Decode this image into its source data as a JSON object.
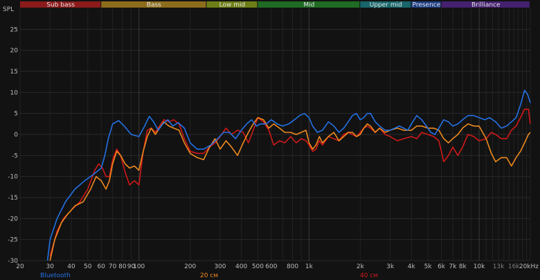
{
  "chart_data": {
    "type": "line",
    "ylabel": "SPL",
    "xscale": "log",
    "xlim": [
      20,
      20000
    ],
    "ylim": [
      -30,
      30
    ],
    "grid": true,
    "legend_position": "bottom",
    "bands": [
      {
        "name": "Sub bass",
        "from": 20,
        "to": 60,
        "color": "#8b1a1a"
      },
      {
        "name": "Bass",
        "from": 60,
        "to": 250,
        "color": "#8d6d1c"
      },
      {
        "name": "Low mid",
        "from": 250,
        "to": 500,
        "color": "#6d7e16"
      },
      {
        "name": "Mid",
        "from": 500,
        "to": 2000,
        "color": "#1f6b23"
      },
      {
        "name": "Upper mid",
        "from": 2000,
        "to": 4000,
        "color": "#18666b"
      },
      {
        "name": "Presence",
        "from": 4000,
        "to": 6000,
        "color": "#1d3d84"
      },
      {
        "name": "Brilliance",
        "from": 6000,
        "to": 20000,
        "color": "#45206f"
      }
    ],
    "x_ticks": [
      {
        "v": 20,
        "label": "20"
      },
      {
        "v": 30,
        "label": "30"
      },
      {
        "v": 40,
        "label": "40"
      },
      {
        "v": 50,
        "label": "50"
      },
      {
        "v": 60,
        "label": "60"
      },
      {
        "v": 70,
        "label": "70"
      },
      {
        "v": 80,
        "label": "80"
      },
      {
        "v": 90,
        "label": "90"
      },
      {
        "v": 100,
        "label": "100"
      },
      {
        "v": 200,
        "label": "200"
      },
      {
        "v": 300,
        "label": "300"
      },
      {
        "v": 400,
        "label": "400"
      },
      {
        "v": 500,
        "label": "500"
      },
      {
        "v": 600,
        "label": "600"
      },
      {
        "v": 800,
        "label": "800"
      },
      {
        "v": 1000,
        "label": "1k"
      },
      {
        "v": 2000,
        "label": "2k"
      },
      {
        "v": 3000,
        "label": "3k"
      },
      {
        "v": 4000,
        "label": "4k"
      },
      {
        "v": 5000,
        "label": "5k"
      },
      {
        "v": 6000,
        "label": "6k"
      },
      {
        "v": 7000,
        "label": "7k"
      },
      {
        "v": 8000,
        "label": "8k"
      },
      {
        "v": 10000,
        "label": "10k"
      },
      {
        "v": 13000,
        "label": "13k",
        "dim": true
      },
      {
        "v": 16000,
        "label": "16k",
        "dim": true
      },
      {
        "v": 20000,
        "label": "20kHz"
      }
    ],
    "y_ticks": [
      -30,
      -25,
      -20,
      -15,
      -10,
      -5,
      0,
      5,
      10,
      15,
      20,
      25
    ],
    "series": [
      {
        "name": "Bluetooth",
        "color": "#2472e6",
        "points": [
          [
            29,
            -30
          ],
          [
            30,
            -25
          ],
          [
            33,
            -20
          ],
          [
            37,
            -16
          ],
          [
            42,
            -13
          ],
          [
            48,
            -11
          ],
          [
            54,
            -9.5
          ],
          [
            60,
            -8
          ],
          [
            63,
            -5
          ],
          [
            66,
            -1
          ],
          [
            70,
            2.5
          ],
          [
            76,
            3.3
          ],
          [
            82,
            2
          ],
          [
            90,
            0
          ],
          [
            100,
            -0.5
          ],
          [
            108,
            2
          ],
          [
            115,
            4.3
          ],
          [
            122,
            3
          ],
          [
            130,
            1
          ],
          [
            138,
            2.5
          ],
          [
            148,
            3.5
          ],
          [
            158,
            2
          ],
          [
            170,
            2.8
          ],
          [
            185,
            1.5
          ],
          [
            200,
            -2
          ],
          [
            220,
            -3.5
          ],
          [
            240,
            -3.5
          ],
          [
            265,
            -2.5
          ],
          [
            290,
            -1
          ],
          [
            315,
            0.5
          ],
          [
            340,
            0.5
          ],
          [
            370,
            -1
          ],
          [
            400,
            1
          ],
          [
            430,
            2.5
          ],
          [
            460,
            3.5
          ],
          [
            490,
            2
          ],
          [
            520,
            2.5
          ],
          [
            560,
            2.5
          ],
          [
            600,
            3.5
          ],
          [
            650,
            2.5
          ],
          [
            700,
            2
          ],
          [
            760,
            2.5
          ],
          [
            820,
            3.5
          ],
          [
            880,
            4.5
          ],
          [
            940,
            5
          ],
          [
            1000,
            4
          ],
          [
            1050,
            2
          ],
          [
            1120,
            0.5
          ],
          [
            1200,
            1
          ],
          [
            1300,
            3
          ],
          [
            1400,
            2
          ],
          [
            1500,
            0.5
          ],
          [
            1600,
            1.5
          ],
          [
            1700,
            3
          ],
          [
            1800,
            4.5
          ],
          [
            1900,
            5
          ],
          [
            2000,
            3.5
          ],
          [
            2100,
            4
          ],
          [
            2200,
            5
          ],
          [
            2300,
            5
          ],
          [
            2450,
            3
          ],
          [
            2600,
            2
          ],
          [
            2800,
            1
          ],
          [
            3000,
            1
          ],
          [
            3200,
            1.5
          ],
          [
            3400,
            2
          ],
          [
            3600,
            1.5
          ],
          [
            3800,
            1
          ],
          [
            4000,
            2.5
          ],
          [
            4300,
            4.5
          ],
          [
            4600,
            3.5
          ],
          [
            4900,
            2
          ],
          [
            5200,
            0.5
          ],
          [
            5500,
            0
          ],
          [
            5800,
            1.5
          ],
          [
            6200,
            3.5
          ],
          [
            6600,
            3
          ],
          [
            7000,
            2
          ],
          [
            7500,
            2.5
          ],
          [
            8000,
            3.5
          ],
          [
            8600,
            4.5
          ],
          [
            9300,
            4.5
          ],
          [
            10000,
            4
          ],
          [
            10800,
            3.5
          ],
          [
            11500,
            4
          ],
          [
            12500,
            3
          ],
          [
            13500,
            1.5
          ],
          [
            14500,
            2
          ],
          [
            15500,
            3
          ],
          [
            16500,
            4
          ],
          [
            17500,
            7
          ],
          [
            18500,
            10.5
          ],
          [
            19300,
            9.5
          ],
          [
            20000,
            7.5
          ]
        ]
      },
      {
        "name": "20 см",
        "color": "#f08a1e",
        "points": [
          [
            30,
            -30
          ],
          [
            32,
            -25
          ],
          [
            35,
            -21
          ],
          [
            38,
            -19
          ],
          [
            42,
            -17
          ],
          [
            47,
            -16
          ],
          [
            52,
            -13
          ],
          [
            56,
            -10
          ],
          [
            60,
            -11
          ],
          [
            64,
            -13
          ],
          [
            67,
            -11
          ],
          [
            70,
            -7
          ],
          [
            74,
            -4
          ],
          [
            78,
            -5
          ],
          [
            83,
            -7
          ],
          [
            88,
            -8
          ],
          [
            94,
            -7.5
          ],
          [
            100,
            -8.5
          ],
          [
            106,
            -4
          ],
          [
            112,
            -0.5
          ],
          [
            118,
            1.5
          ],
          [
            125,
            0
          ],
          [
            132,
            1.5
          ],
          [
            140,
            3
          ],
          [
            150,
            2
          ],
          [
            160,
            1.5
          ],
          [
            172,
            1
          ],
          [
            185,
            -2
          ],
          [
            200,
            -4.5
          ],
          [
            220,
            -5.5
          ],
          [
            240,
            -6
          ],
          [
            260,
            -3
          ],
          [
            280,
            -1
          ],
          [
            300,
            -3.5
          ],
          [
            325,
            -1.5
          ],
          [
            350,
            -3
          ],
          [
            380,
            -5
          ],
          [
            410,
            -2
          ],
          [
            440,
            0.5
          ],
          [
            470,
            2.5
          ],
          [
            500,
            4
          ],
          [
            540,
            3.5
          ],
          [
            580,
            1.5
          ],
          [
            620,
            2.5
          ],
          [
            670,
            1.5
          ],
          [
            720,
            0.5
          ],
          [
            780,
            0.5
          ],
          [
            840,
            0
          ],
          [
            900,
            0.5
          ],
          [
            960,
            1
          ],
          [
            1000,
            -2
          ],
          [
            1050,
            -3.5
          ],
          [
            1100,
            -2.5
          ],
          [
            1150,
            -0.5
          ],
          [
            1200,
            -2
          ],
          [
            1300,
            -0.5
          ],
          [
            1400,
            0.5
          ],
          [
            1500,
            -1.5
          ],
          [
            1600,
            -0.5
          ],
          [
            1700,
            0.5
          ],
          [
            1800,
            0.5
          ],
          [
            1900,
            -0.5
          ],
          [
            2000,
            0
          ],
          [
            2100,
            1.5
          ],
          [
            2200,
            2.5
          ],
          [
            2300,
            2
          ],
          [
            2450,
            0.5
          ],
          [
            2600,
            1.5
          ],
          [
            2800,
            0.5
          ],
          [
            3000,
            1
          ],
          [
            3300,
            1.5
          ],
          [
            3600,
            1
          ],
          [
            4000,
            1
          ],
          [
            4300,
            2
          ],
          [
            4600,
            2
          ],
          [
            5000,
            1.5
          ],
          [
            5400,
            1.5
          ],
          [
            5800,
            1
          ],
          [
            6200,
            -1
          ],
          [
            6600,
            -2
          ],
          [
            7000,
            -1
          ],
          [
            7500,
            0
          ],
          [
            8000,
            1.5
          ],
          [
            8600,
            2.5
          ],
          [
            9300,
            2
          ],
          [
            10000,
            2
          ],
          [
            11000,
            -1
          ],
          [
            11800,
            -4.5
          ],
          [
            12500,
            -6.5
          ],
          [
            13500,
            -5.5
          ],
          [
            14500,
            -5.5
          ],
          [
            15500,
            -7.5
          ],
          [
            16500,
            -5.5
          ],
          [
            17500,
            -4
          ],
          [
            18500,
            -2
          ],
          [
            19500,
            0
          ],
          [
            20000,
            0.5
          ]
        ]
      },
      {
        "name": "40 см",
        "color": "#d11919",
        "points": [
          [
            30,
            -29
          ],
          [
            33,
            -23
          ],
          [
            36,
            -20
          ],
          [
            40,
            -18
          ],
          [
            45,
            -16
          ],
          [
            50,
            -13
          ],
          [
            55,
            -8.5
          ],
          [
            58,
            -7
          ],
          [
            61,
            -8
          ],
          [
            64,
            -10
          ],
          [
            67,
            -10
          ],
          [
            70,
            -6
          ],
          [
            74,
            -3.5
          ],
          [
            78,
            -5
          ],
          [
            83,
            -9
          ],
          [
            88,
            -12
          ],
          [
            94,
            -11
          ],
          [
            100,
            -12
          ],
          [
            106,
            -4
          ],
          [
            112,
            1
          ],
          [
            118,
            1.5
          ],
          [
            125,
            0.5
          ],
          [
            132,
            2
          ],
          [
            140,
            3.5
          ],
          [
            150,
            3
          ],
          [
            160,
            3.5
          ],
          [
            172,
            2.5
          ],
          [
            185,
            -1
          ],
          [
            200,
            -4
          ],
          [
            220,
            -4.5
          ],
          [
            240,
            -4.5
          ],
          [
            260,
            -3
          ],
          [
            280,
            -2
          ],
          [
            300,
            -0.5
          ],
          [
            325,
            1.5
          ],
          [
            350,
            0
          ],
          [
            380,
            1
          ],
          [
            410,
            0.5
          ],
          [
            440,
            -2
          ],
          [
            470,
            1
          ],
          [
            500,
            4
          ],
          [
            540,
            3
          ],
          [
            580,
            1
          ],
          [
            620,
            -2.5
          ],
          [
            670,
            -1.5
          ],
          [
            720,
            -2
          ],
          [
            780,
            -0.5
          ],
          [
            840,
            -2
          ],
          [
            900,
            -1
          ],
          [
            960,
            -1.5
          ],
          [
            1000,
            -2.5
          ],
          [
            1050,
            -4
          ],
          [
            1100,
            -3.5
          ],
          [
            1150,
            -1.5
          ],
          [
            1200,
            -2.5
          ],
          [
            1300,
            -0.5
          ],
          [
            1400,
            -1
          ],
          [
            1500,
            -1.5
          ],
          [
            1600,
            0
          ],
          [
            1700,
            0.5
          ],
          [
            1800,
            0
          ],
          [
            1900,
            -0.5
          ],
          [
            2000,
            0.5
          ],
          [
            2100,
            1.5
          ],
          [
            2200,
            2
          ],
          [
            2300,
            1.5
          ],
          [
            2450,
            0.5
          ],
          [
            2600,
            1.5
          ],
          [
            2800,
            0
          ],
          [
            3000,
            -0.5
          ],
          [
            3300,
            -1.5
          ],
          [
            3600,
            -1
          ],
          [
            4000,
            -0.5
          ],
          [
            4300,
            -1
          ],
          [
            4600,
            0.5
          ],
          [
            5000,
            0
          ],
          [
            5400,
            -0.5
          ],
          [
            5800,
            -1.5
          ],
          [
            6200,
            -6.5
          ],
          [
            6600,
            -5
          ],
          [
            7000,
            -3
          ],
          [
            7500,
            -5
          ],
          [
            8000,
            -3
          ],
          [
            8600,
            0
          ],
          [
            9300,
            -0.5
          ],
          [
            10000,
            -1.5
          ],
          [
            11000,
            -1
          ],
          [
            11800,
            0.5
          ],
          [
            12500,
            0
          ],
          [
            13500,
            -1
          ],
          [
            14500,
            -1
          ],
          [
            15500,
            1
          ],
          [
            16500,
            2
          ],
          [
            17500,
            4
          ],
          [
            18500,
            6
          ],
          [
            19500,
            6
          ],
          [
            20000,
            2.5
          ]
        ]
      }
    ]
  }
}
